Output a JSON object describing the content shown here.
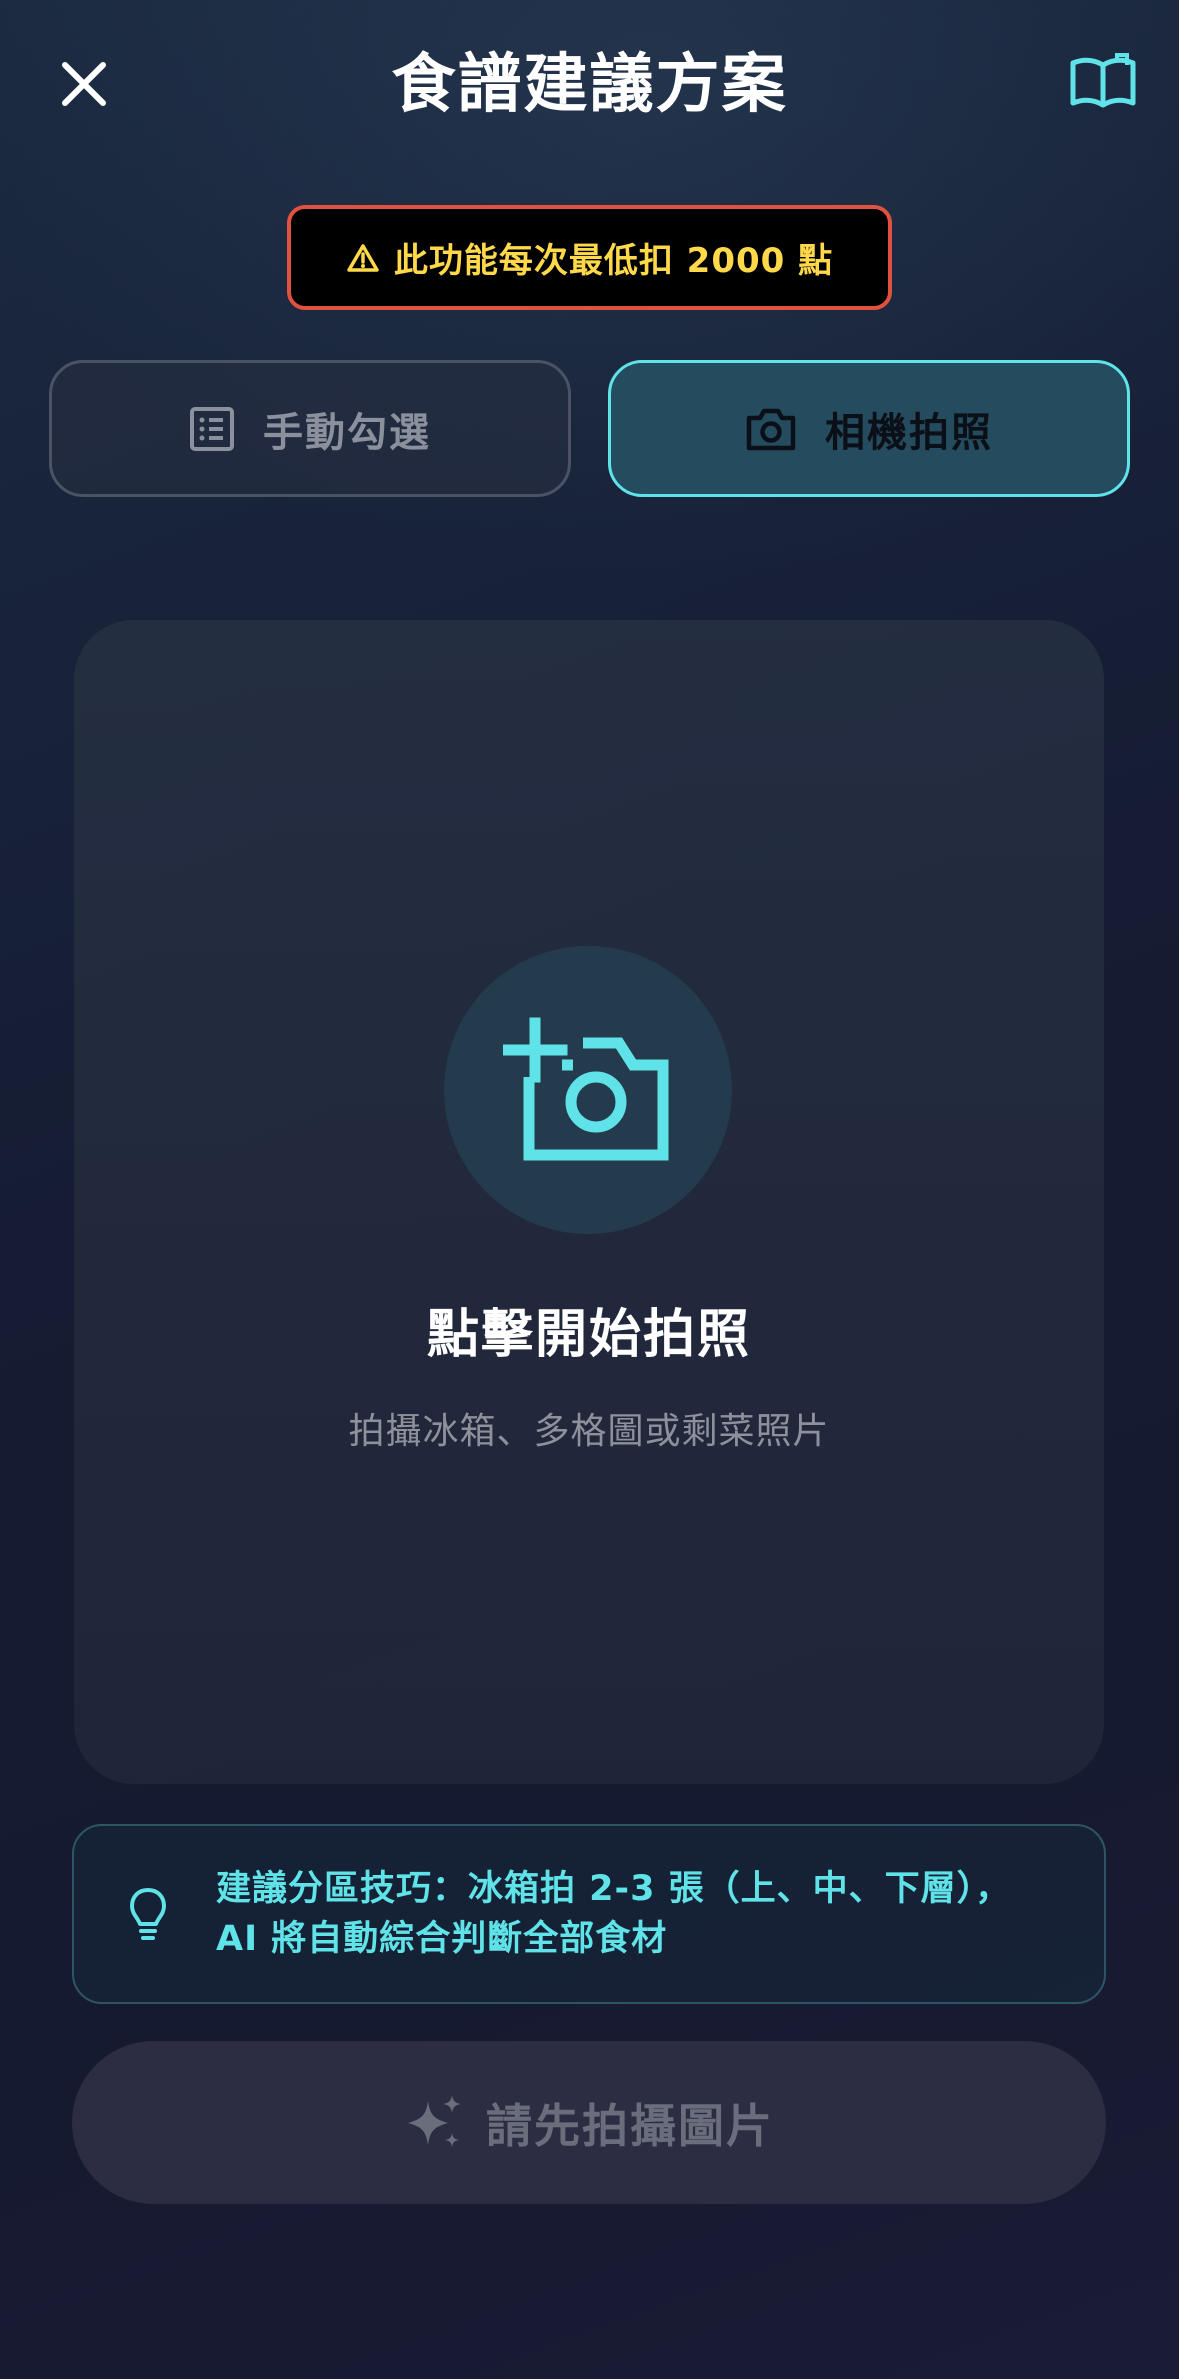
{
  "header": {
    "title": "食譜建議方案",
    "close_icon": "close-icon",
    "book_icon": "open-book-icon"
  },
  "warning": {
    "icon": "warning-triangle-icon",
    "text": "此功能每次最低扣 2000 點"
  },
  "modes": [
    {
      "label": "手動勾選",
      "icon": "checklist-icon",
      "selected": false
    },
    {
      "label": "相機拍照",
      "icon": "camera-icon",
      "selected": true
    }
  ],
  "photo_area": {
    "icon": "add-photo-camera-icon",
    "title": "點擊開始拍照",
    "subtitle": "拍攝冰箱、多格圖或剩菜照片"
  },
  "tip": {
    "icon": "lightbulb-icon",
    "line1": "建議分區技巧：冰箱拍 2-3 張（上、中、下層），",
    "line2": "AI 將自動綜合判斷全部食材"
  },
  "submit": {
    "icon": "sparkle-icon",
    "label": "請先拍攝圖片",
    "enabled": false
  },
  "colors": {
    "accent": "#5fe3e8",
    "warning_border": "#e0513f",
    "warning_text": "#ffd94a",
    "selected_bg": "#244c5e"
  }
}
